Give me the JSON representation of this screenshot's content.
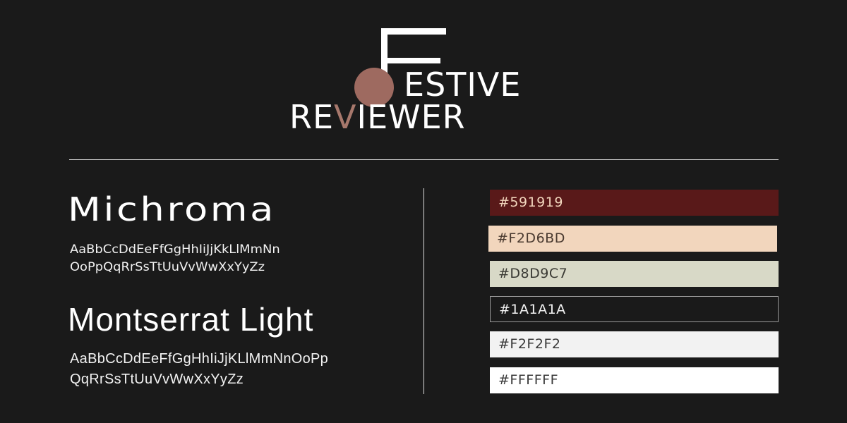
{
  "logo": {
    "line1": "ESTIVE",
    "line2_a": "RE",
    "line2_v": "V",
    "line2_b": "IEWER",
    "dot_color": "#9e6a60",
    "accent_color": "#a7786c"
  },
  "fonts": [
    {
      "name": "Michroma",
      "alphabet_line1": "AaBbCcDdEeFfGgHhIiJjKkLlMmNn",
      "alphabet_line2": "OoPpQqRrSsTtUuVvWwXxYyZz"
    },
    {
      "name": "Montserrat Light",
      "alphabet_line1": "AaBbCcDdEeFfGgHhIiJjKLlMmNnOoPp",
      "alphabet_line2": "QqRrSsTtUuVvWwXxYyZz"
    }
  ],
  "swatches": [
    {
      "label": "#591919",
      "color": "#591919",
      "text_color": "#f2d6bd",
      "bordered": false
    },
    {
      "label": "#F2D6BD",
      "color": "#f2d6bd",
      "text_color": "#4a3a30",
      "bordered": false
    },
    {
      "label": "#D8D9C7",
      "color": "#d8d9c7",
      "text_color": "#3a3a34",
      "bordered": false
    },
    {
      "label": "#1A1A1A",
      "color": "#1a1a1a",
      "text_color": "#f2f2f2",
      "bordered": true
    },
    {
      "label": "#F2F2F2",
      "color": "#f2f2f2",
      "text_color": "#3a3a3a",
      "bordered": false
    },
    {
      "label": "#FFFFFF",
      "color": "#ffffff",
      "text_color": "#3a3a3a",
      "bordered": false
    }
  ]
}
